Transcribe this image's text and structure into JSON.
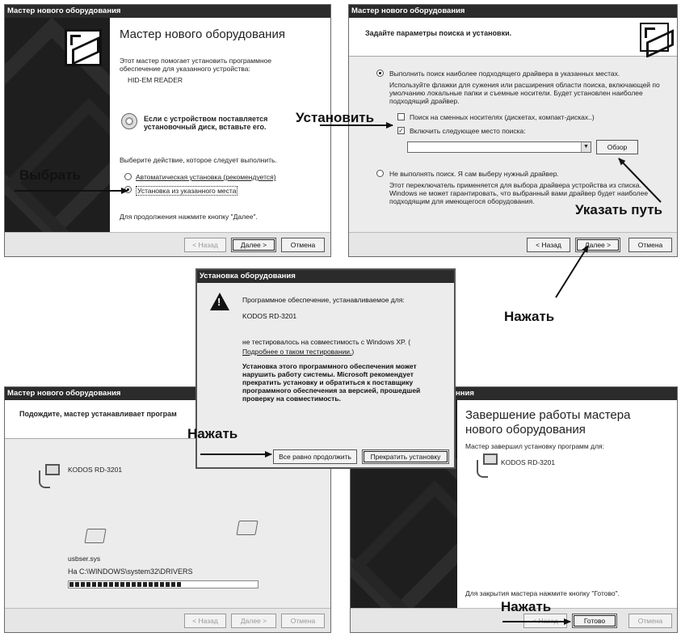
{
  "w1": {
    "title": "Мастер нового оборудования",
    "heading": "Мастер нового оборудования",
    "intro": "Этот мастер помогает установить программное обеспечение для указанного устройства:",
    "device": "HID-EM READER",
    "cd_note": "Если с устройством поставляется установочный диск, вставьте его.",
    "choose": "Выберите действие, которое следует выполнить.",
    "opt_auto": "Автоматическая установка (рекомендуется)",
    "opt_manual": "Установка из указанного места",
    "next_hint": "Для продолжения нажмите кнопку \"Далее\".",
    "back": "< Назад",
    "next": "Далее >",
    "cancel": "Отмена"
  },
  "w2": {
    "title": "Мастер нового оборудования",
    "header": "Задайте параметры поиска и установки.",
    "opt_search": "Выполнить поиск наиболее подходящего драйвера в указанных местах.",
    "search_desc": "Используйте флажки для сужения или расширения области поиска, включающей по умолчанию локальные папки и съемные носители. Будет установлен наиболее подходящий драйвер.",
    "chk_removable": "Поиск на сменных носителях (дискетах, компакт-дисках..)",
    "chk_include": "Включить следующее место поиска:",
    "path_value": "",
    "browse": "Обзор",
    "opt_nosearch": "Не выполнять поиск. Я сам выберу нужный драйвер.",
    "nosearch_desc": "Этот переключатель применяется для выбора драйвера устройства из списка. Windows не может гарантировать, что выбранный вами драйвер будет наиболее подходящим для имеющегося оборудования.",
    "back": "< Назад",
    "next": "Далее >",
    "cancel": "Отмена"
  },
  "w3": {
    "title": "Мастер нового оборудования",
    "header": "Подождите, мастер устанавливает програм",
    "device": "KODOS RD-3201",
    "file": "usbser.sys",
    "dest": "На C:\\WINDOWS\\system32\\DRIVERS",
    "progress": 0.6,
    "back": "< Назад",
    "next": "Далее >",
    "cancel": "Отмена"
  },
  "w4": {
    "title": "нния",
    "heading": "Завершение работы мастера нового оборудования",
    "done": "Мастер завершил установку программ для:",
    "device": "KODOS RD-3201",
    "finish_hint": "Для закрытия мастера нажмите кнопку \"Готово\".",
    "back": "< Назад",
    "finish": "Готово",
    "cancel": "Отмена"
  },
  "dlg": {
    "title": "Установка оборудования",
    "line1": "Программное обеспечение, устанавливаемое для:",
    "device": "KODOS RD-3201",
    "line2": "не тестировалось на совместимость с Windows XP. (",
    "link": "Подробнее о таком тестировании.",
    "link_end": ")",
    "warning": "Установка этого программного обеспечения может нарушить работу системы. Microsoft рекомендует прекратить установку и обратиться к поставщику программного обеспечения за версией, прошедшей проверку на совместимость.",
    "continue": "Все равно продолжить",
    "stop": "Прекратить установку"
  },
  "annotations": {
    "select": "Выбрать",
    "install": "Установить",
    "specify_path": "Указать путь",
    "press1": "Нажать",
    "press2": "Нажать",
    "press3": "Нажать"
  }
}
